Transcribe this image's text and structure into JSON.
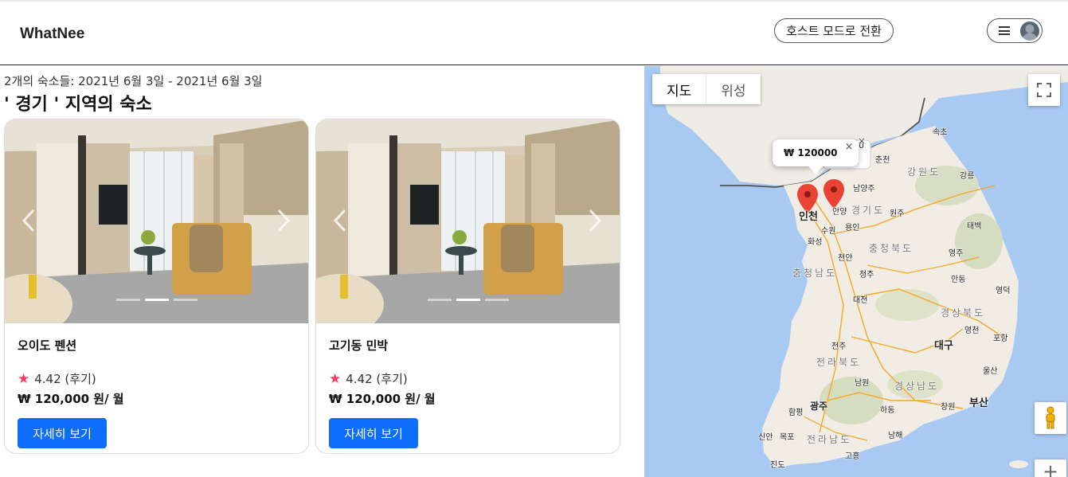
{
  "header": {
    "brand": "WhatNee",
    "host_mode_label": "호스트 모드로 전환"
  },
  "search": {
    "summary": "2개의 숙소들: 2021년 6월 3일 - 2021년 6월 3일",
    "region_title": "' 경기 ' 지역의 숙소"
  },
  "listings": [
    {
      "name": "오이도 펜션",
      "rating": "4.42 (후기)",
      "price": "₩ 120,000 원/ 월",
      "button_label": "자세히 보기",
      "carousel_index": 2,
      "carousel_count": 3
    },
    {
      "name": "고기동 민박",
      "rating": "4.42 (후기)",
      "price": "₩ 120,000 원/ 월",
      "button_label": "자세히 보기",
      "carousel_index": 2,
      "carousel_count": 3
    }
  ],
  "map": {
    "tab_map": "지도",
    "tab_satellite": "위성",
    "info_window_price": "₩ 120000",
    "info_window_behind": "00",
    "close_symbol": "×",
    "zoom_in_symbol": "+",
    "cities": {
      "sokcho": "속초",
      "chuncheon": "춘천",
      "gangneung": "강릉",
      "namyangju": "남양주",
      "incheon": "인천",
      "anyang": "안양",
      "suwon": "수원",
      "yongin": "용인",
      "wonju": "원주",
      "hwaseong": "화성",
      "taebaek": "태백",
      "cheonan": "천안",
      "yeongju": "영주",
      "cheongju": "청주",
      "andong": "안동",
      "daejeon": "대전",
      "yeongdeok": "영덕",
      "yeongcheon": "영천",
      "pohang": "포항",
      "jeonju": "전주",
      "daegu": "대구",
      "ulsan": "울산",
      "namwon": "남원",
      "gwangju": "광주",
      "busan": "부산",
      "hampyeong": "함평",
      "changwon": "창원",
      "hadong": "하동",
      "sinan": "신안",
      "mokpo": "목포",
      "namhae": "남해",
      "goheung": "고흥",
      "jindo": "진도"
    },
    "provinces": {
      "gangwon": "강원도",
      "gyeonggi": "경기도",
      "chungbuk": "충청북도",
      "chungnam": "충청남도",
      "gyeongbuk": "경상북도",
      "jeonbuk": "전라북도",
      "gyeongnam": "경상남도",
      "jeonnam": "전라남도"
    },
    "colors": {
      "water": "#a7c9f2",
      "land": "#f1ede4",
      "marker": "#ea4335",
      "road": "#f5a623"
    }
  },
  "colors": {
    "primary_button": "#0d6efd",
    "star": "#ff385c"
  }
}
